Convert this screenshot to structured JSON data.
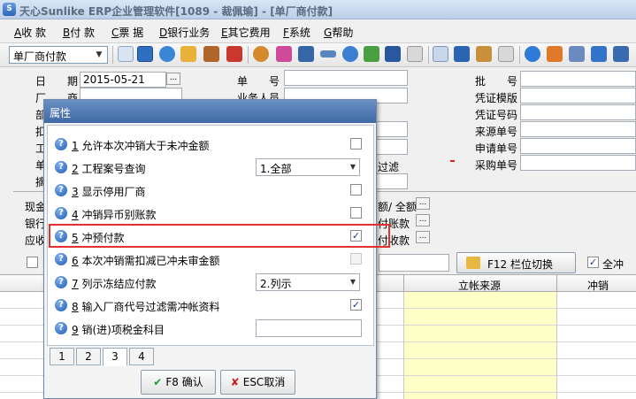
{
  "window": {
    "title": "天心Sunlike ERP企业管理软件[1089 - 裁佩瑜] - [单厂商付款]"
  },
  "menu": [
    {
      "key": "A",
      "label": "收 款"
    },
    {
      "key": "B",
      "label": "付 款"
    },
    {
      "key": "C",
      "label": "票 据"
    },
    {
      "key": "D",
      "label": "银行业务"
    },
    {
      "key": "E",
      "label": "其它费用"
    },
    {
      "key": "F",
      "label": "系统"
    },
    {
      "key": "G",
      "label": "帮助"
    }
  ],
  "toolbar": {
    "doc_type": "单厂商付款"
  },
  "form": {
    "date_label": "日　　期",
    "date_value": "2015-05-21",
    "date_btn": "...",
    "vendor_label": "厂　　商",
    "dept_label": "部",
    "deduct_label": "扣",
    "project_label": "工",
    "doc_label": "单",
    "summary_label": "摘",
    "order_no_label": "单　　号",
    "salesperson_label": "业务人员",
    "filter_btn": "过滤",
    "batch_label": "批　　号",
    "voucher_tpl_label": "凭证模版",
    "voucher_no_label": "凭证号码",
    "source_no_label": "来源单号",
    "apply_no_label": "申请单号",
    "purchase_no_label": "采购单号",
    "cash_label": "现金",
    "bank_label": "银行",
    "receivable_label": "应收",
    "total_label": "额/ 全额",
    "pay_account_label": "付账款",
    "pay_receipt_label": "付收款",
    "more_btn": "...",
    "f12_btn": "F12 栏位切换",
    "all_label": "全冲"
  },
  "grid": {
    "headers": [
      "立帐来源",
      "冲销"
    ]
  },
  "dialog": {
    "title": "属性",
    "rows": [
      {
        "num": "1",
        "label": "允许本次冲销大于未冲金额",
        "control": "checkbox",
        "checked": false
      },
      {
        "num": "2",
        "label": "工程案号查询",
        "control": "select",
        "value": "1.全部"
      },
      {
        "num": "3",
        "label": "显示停用厂商",
        "control": "checkbox",
        "checked": false
      },
      {
        "num": "4",
        "label": "冲销异币别账款",
        "control": "checkbox",
        "checked": false
      },
      {
        "num": "5",
        "label": "冲预付款",
        "control": "checkbox",
        "checked": true
      },
      {
        "num": "6",
        "label": "本次冲销需扣减已冲未审金额",
        "control": "checkbox-disabled",
        "checked": false
      },
      {
        "num": "7",
        "label": "列示冻结应付款",
        "control": "select",
        "value": "2.列示"
      },
      {
        "num": "8",
        "label": "输入厂商代号过滤需冲帐资料",
        "control": "checkbox",
        "checked": true
      },
      {
        "num": "9",
        "label": "销(进)项税金科目",
        "control": "text",
        "value": ""
      }
    ],
    "tabs": [
      "1",
      "2",
      "3",
      "4"
    ],
    "ok_label": "F8 确认",
    "cancel_label": "ESC取消",
    "check_mark": "✓"
  }
}
